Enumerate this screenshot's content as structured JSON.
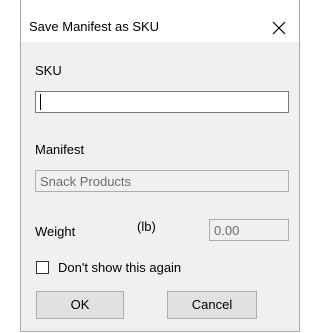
{
  "window": {
    "title": "Save Manifest as SKU",
    "close_icon": "close-icon"
  },
  "sku": {
    "label": "SKU",
    "value": ""
  },
  "manifest": {
    "label": "Manifest",
    "value": "Snack Products"
  },
  "weight": {
    "label": "Weight",
    "unit": "(lb)",
    "value": "0.00"
  },
  "options": {
    "dont_show_label": "Don't show this again",
    "dont_show_checked": false
  },
  "buttons": {
    "ok_label": "OK",
    "cancel_label": "Cancel"
  },
  "colors": {
    "dialog_bg": "#f0f0f0",
    "titlebar_bg": "#ffffff",
    "disabled_text": "#6d6d6d",
    "button_bg": "#e1e1e1"
  }
}
